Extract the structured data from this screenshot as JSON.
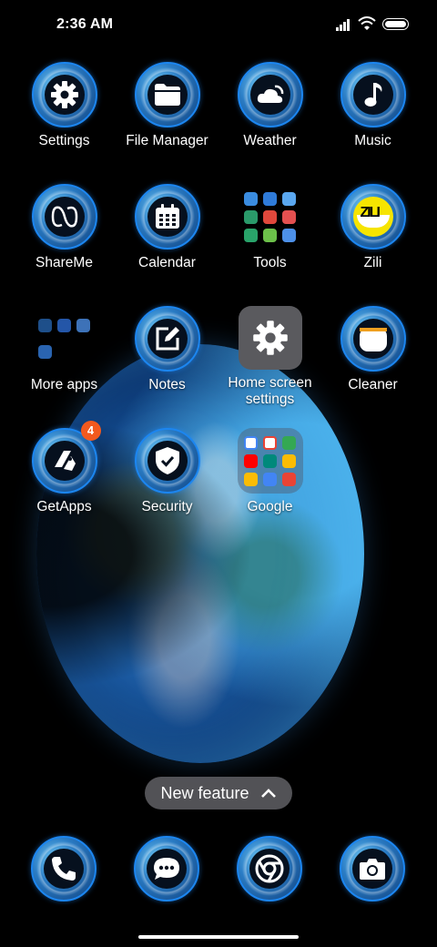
{
  "status_bar": {
    "time": "2:36 AM",
    "icons": [
      "signal-icon",
      "wifi-icon",
      "battery-icon"
    ]
  },
  "apps": {
    "settings": "Settings",
    "file_manager": "File Manager",
    "weather": "Weather",
    "music": "Music",
    "shareme": "ShareMe",
    "calendar": "Calendar",
    "tools": "Tools",
    "zili": "Zili",
    "more_apps": "More apps",
    "notes": "Notes",
    "home_screen_settings": "Home screen settings",
    "cleaner": "Cleaner",
    "getapps": "GetApps",
    "getapps_badge": "4",
    "security": "Security",
    "google": "Google"
  },
  "new_feature": {
    "label": "New feature"
  },
  "dock": [
    "phone-icon",
    "messages-icon",
    "chrome-icon",
    "camera-icon"
  ],
  "colors": {
    "ring": "#1c86f0",
    "badge": "#f2591e",
    "pill": "#6e6e73"
  }
}
